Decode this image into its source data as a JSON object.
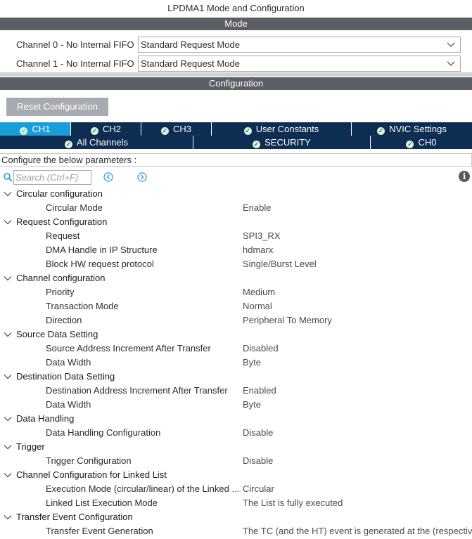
{
  "window_title": "LPDMA1 Mode and Configuration",
  "mode_section": {
    "title": "Mode",
    "channels": [
      {
        "label": "Channel 0  - No Internal FIFO",
        "value": "Standard Request Mode"
      },
      {
        "label": "Channel 1  - No Internal FIFO",
        "value": "Standard Request Mode"
      }
    ]
  },
  "config_section": {
    "title": "Configuration",
    "reset_label": "Reset Configuration"
  },
  "tabs_row1": [
    {
      "label": "CH1",
      "active": true
    },
    {
      "label": "CH2",
      "active": false
    },
    {
      "label": "CH3",
      "active": false
    },
    {
      "label": "User Constants",
      "active": false
    },
    {
      "label": "NVIC Settings",
      "active": false
    }
  ],
  "tabs_row2": [
    {
      "label": "All Channels",
      "active": false
    },
    {
      "label": "SECURITY",
      "active": false
    },
    {
      "label": "CH0",
      "active": false
    }
  ],
  "instruction": "Configure the below parameters :",
  "search": {
    "placeholder": "Search (Ctrl+F)"
  },
  "icons": {
    "search": "search-icon",
    "prev": "arrow-left-circle-icon",
    "next": "arrow-right-circle-icon",
    "info": "info-icon",
    "check": "check-circle-icon",
    "caret": "chevron-down-icon"
  },
  "colors": {
    "section_bar": "#5b5e63",
    "tab_dark": "#0d2d52",
    "tab_active": "#1a9ed9",
    "button_gray": "#a7aaae"
  },
  "tree": [
    {
      "group": "Circular configuration",
      "params": [
        {
          "name": "Circular Mode",
          "value": "Enable"
        }
      ]
    },
    {
      "group": "Request Configuration",
      "params": [
        {
          "name": "Request",
          "value": "SPI3_RX"
        },
        {
          "name": "DMA Handle in IP Structure",
          "value": "hdmarx"
        },
        {
          "name": "Block HW request protocol",
          "value": "Single/Burst Level"
        }
      ]
    },
    {
      "group": "Channel configuration",
      "params": [
        {
          "name": "Priority",
          "value": "Medium"
        },
        {
          "name": "Transaction Mode",
          "value": "Normal"
        },
        {
          "name": "Direction",
          "value": "Peripheral To Memory"
        }
      ]
    },
    {
      "group": "Source Data Setting",
      "params": [
        {
          "name": "Source Address Increment After Transfer",
          "value": "Disabled"
        },
        {
          "name": "Data Width",
          "value": "Byte"
        }
      ]
    },
    {
      "group": "Destination Data Setting",
      "params": [
        {
          "name": "Destination Address Increment After Transfer",
          "value": "Enabled"
        },
        {
          "name": "Data Width",
          "value": "Byte"
        }
      ]
    },
    {
      "group": "Data Handling",
      "params": [
        {
          "name": "Data Handling Configuration",
          "value": "Disable"
        }
      ]
    },
    {
      "group": "Trigger",
      "params": [
        {
          "name": "Trigger Configuration",
          "value": "Disable"
        }
      ]
    },
    {
      "group": "Channel Configuration for Linked List",
      "params": [
        {
          "name": "Execution Mode (circular/linear) of the Linked ...",
          "value": "Circular"
        },
        {
          "name": "Linked List Execution Mode",
          "value": "The List is fully executed"
        }
      ]
    },
    {
      "group": "Transfer Event Configuration",
      "params": [
        {
          "name": "Transfer Event Generation",
          "value": "The TC (and the HT) event is generated at the (respectiv..."
        }
      ]
    }
  ]
}
